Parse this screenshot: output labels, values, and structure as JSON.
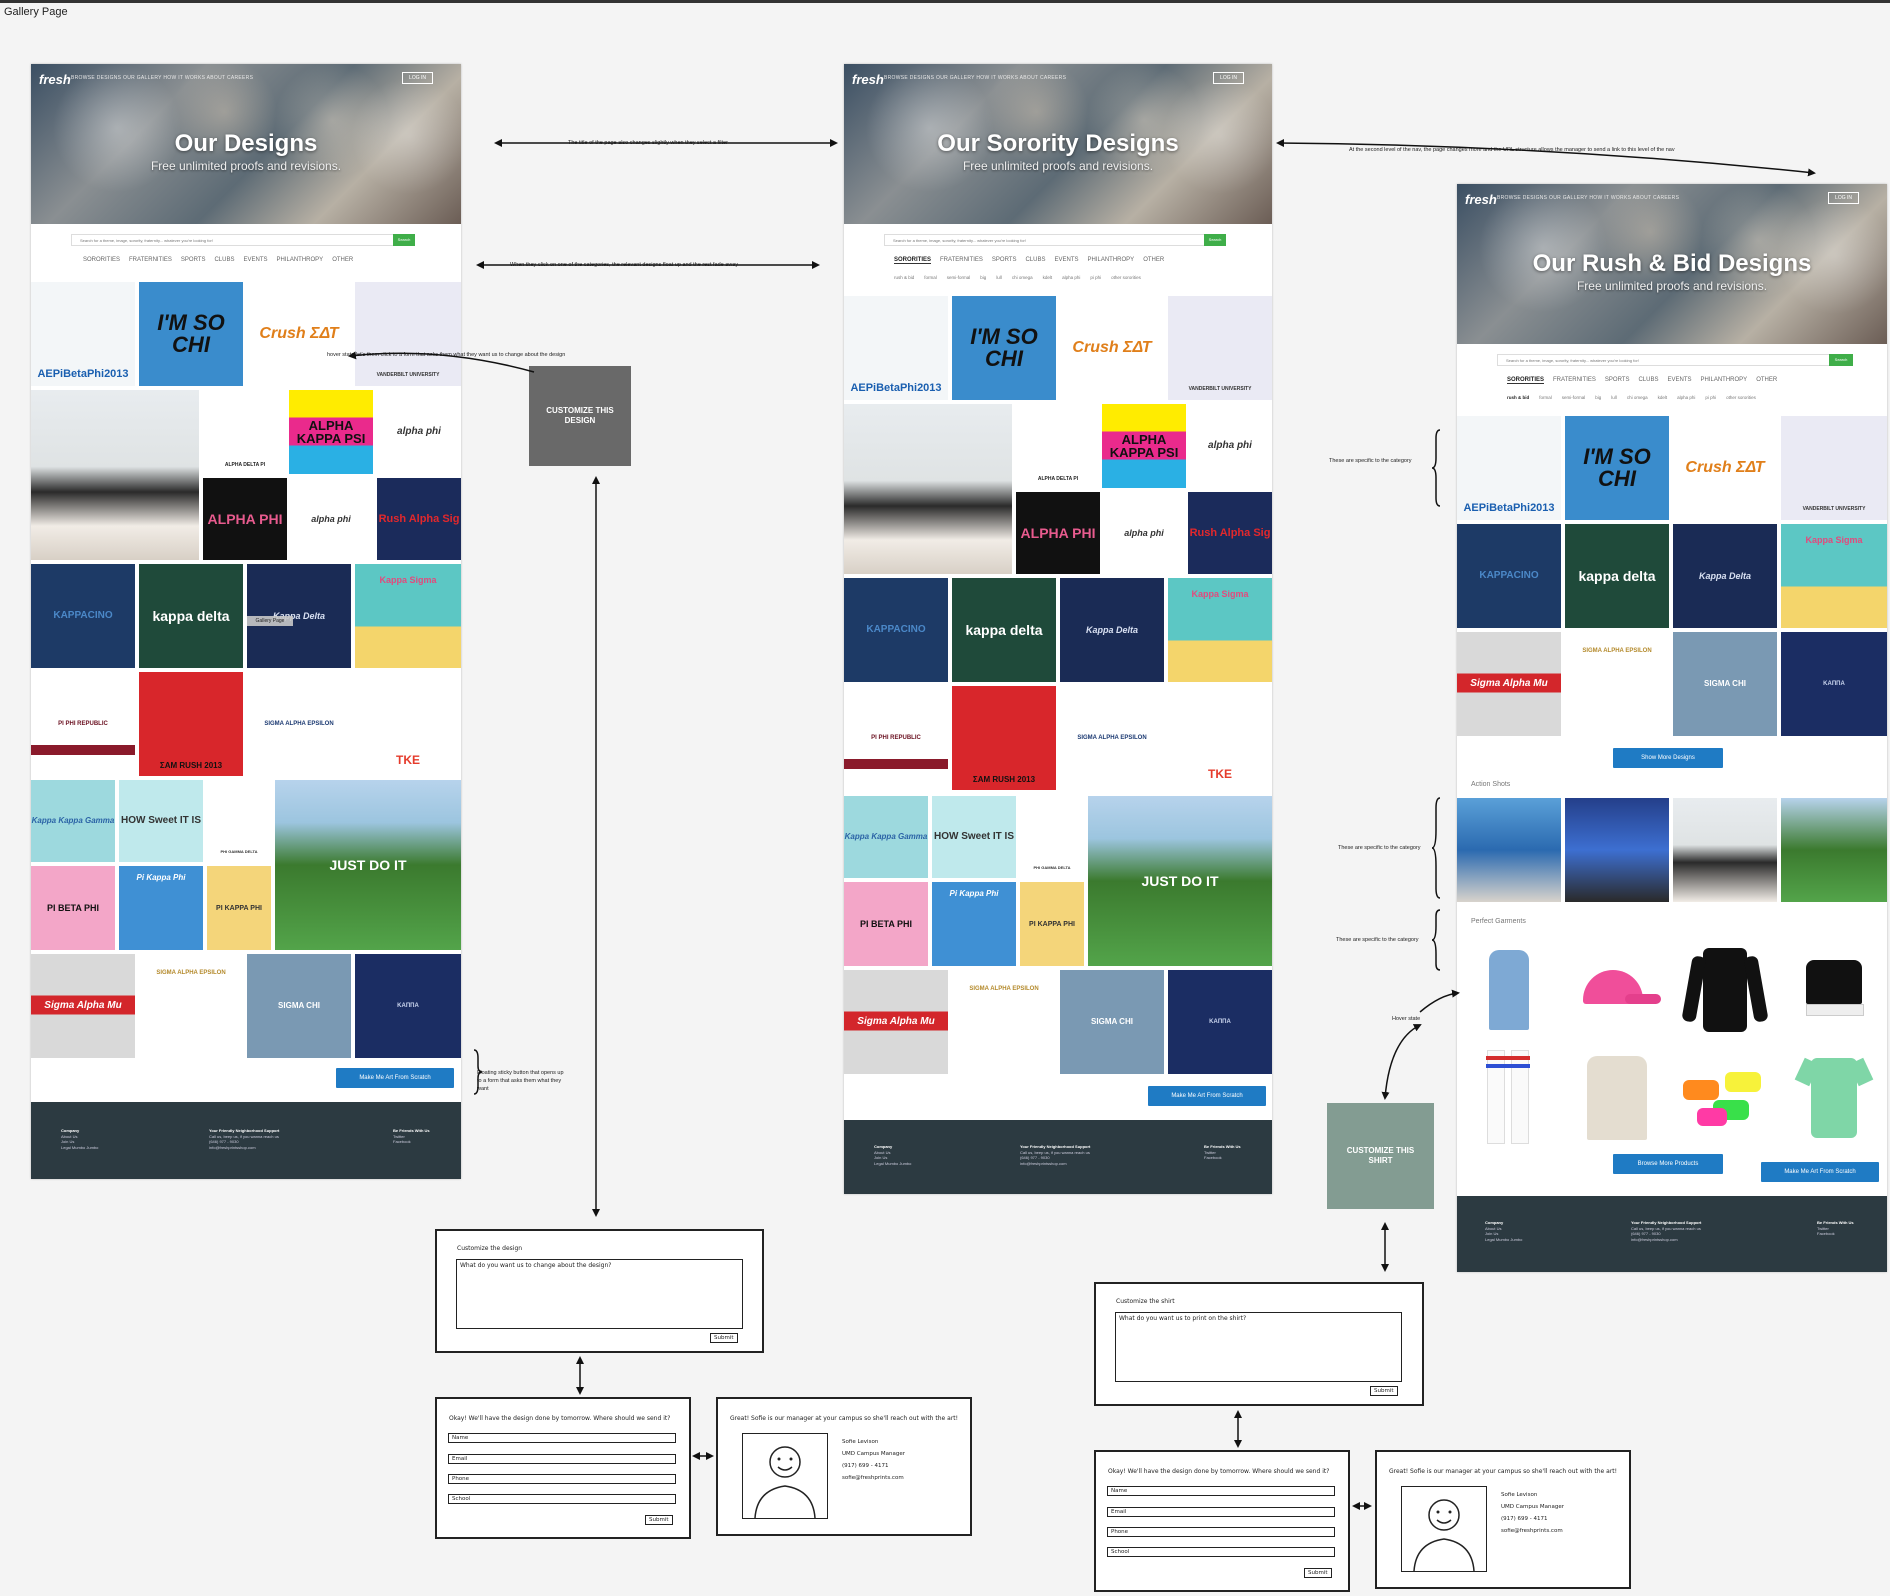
{
  "canvas": {
    "title": "Gallery Page"
  },
  "pages": [
    {
      "hero": {
        "logo": "fresh",
        "nav": "BROWSE DESIGNS   OUR GALLERY   HOW IT WORKS   ABOUT   CAREERS",
        "nav_button": "LOG IN",
        "title": "Our Designs",
        "subtitle": "Free unlimited proofs and revisions."
      },
      "search": {
        "placeholder": "Search for a theme, image, sorority, fraternity... whatever you're looking for!",
        "button": "Search"
      },
      "categories": [
        "SORORITIES",
        "FRATERNITIES",
        "SPORTS",
        "CLUBS",
        "EVENTS",
        "PHILANTHROPY",
        "OTHER"
      ],
      "cta": "Make Me Art From Scratch"
    },
    {
      "hero": {
        "logo": "fresh",
        "nav": "BROWSE DESIGNS   OUR GALLERY   HOW IT WORKS   ABOUT   CAREERS",
        "nav_button": "LOG IN",
        "title": "Our Sorority Designs",
        "subtitle": "Free unlimited proofs and revisions."
      },
      "search": {
        "placeholder": "Search for a theme, image, sorority, fraternity... whatever you're looking for!",
        "button": "Search"
      },
      "categories": [
        "SORORITIES",
        "FRATERNITIES",
        "SPORTS",
        "CLUBS",
        "EVENTS",
        "PHILANTHROPY",
        "OTHER"
      ],
      "subcategories": [
        "rush & bid",
        "formal",
        "semi-formal",
        "big",
        "lull",
        "chi omega",
        "kdelt",
        "alpha phi",
        "pi phi",
        "other sororities"
      ],
      "cta": "Make Me Art From Scratch"
    },
    {
      "hero": {
        "logo": "fresh",
        "nav": "BROWSE DESIGNS   OUR GALLERY   HOW IT WORKS   ABOUT   CAREERS",
        "nav_button": "LOG IN",
        "title": "Our Rush & Bid Designs",
        "subtitle": "Free unlimited proofs and revisions."
      },
      "search": {
        "placeholder": "Search for a theme, image, sorority, fraternity... whatever you're looking for!",
        "button": "Search"
      },
      "categories": [
        "SORORITIES",
        "FRATERNITIES",
        "SPORTS",
        "CLUBS",
        "EVENTS",
        "PHILANTHROPY",
        "OTHER"
      ],
      "subcategories": [
        "rush & bid",
        "formal",
        "semi-formal",
        "big",
        "lull",
        "chi omega",
        "kdelt",
        "alpha phi",
        "pi phi",
        "other sororities"
      ],
      "show_more": "Show More Designs",
      "action_shots_label": "Action Shots",
      "garments_label": "Perfect Garments",
      "browse_products": "Browse More Products",
      "cta": "Make Me Art From Scratch"
    }
  ],
  "tiles": {
    "aepi": "AEPiBetaPhi2013",
    "so_chi": "I'M SO CHI",
    "crush": "Crush ΣΔΤ",
    "peace": "VANDERBILT UNIVERSITY",
    "adpi": "ALPHA DELTA PI",
    "akpsi": "ALPHA KAPPA PSI",
    "aphi_circle": "alpha phi",
    "alpha_phi": "ALPHA PHI",
    "skull": "alpha phi",
    "rush_alpha_sig": "Rush Alpha Sig",
    "kappacino": "KAPPACINO",
    "kappa_delta": "kappa delta",
    "lighthouse": "Kappa Delta",
    "surf": "Kappa Sigma",
    "piphi_republic": "PI PHI REPUBLIC",
    "sam": "ΣΑΜ RUSH 2013",
    "sae_usa": "SIGMA ALPHA EPSILON",
    "tke": "TKE",
    "kappa_banner": "Kappa Kappa Gamma",
    "how_sweet": "HOW Sweet IT IS",
    "pi_gamma": "PHI GAMMA DELTA",
    "just_do_it": "JUST DO IT",
    "pi_beta_phi": "PI BETA PHI",
    "pi_kappa_phi_sand": "Pi Kappa Phi",
    "pi_kappa_phi": "PI KAPPA PHI",
    "sigma_alpha_mu": "Sigma Alpha Mu",
    "sae_lion": "SIGMA ALPHA EPSILON",
    "sigma_chi": "SIGMA CHI",
    "crest": "ΚΑΠΠΑ"
  },
  "footer": {
    "company_heading": "Company",
    "company_links": "About Us\nJoin Us\nLegal Mumbo Jumbo",
    "support_heading": "Your Friendly Neighborhood Support",
    "support_text": "Call us, beep us, if you wanna reach us\n(646) 977 - 9030\ninfo@freshprintsshop.com",
    "social_heading": "Be Friends With Us",
    "social_links": "Twitter\nFacebook"
  },
  "hover_states": {
    "customize_design": "CUSTOMIZE THIS DESIGN",
    "customize_shirt": "CUSTOMIZE THIS SHIRT",
    "small_hover_tag": "Gallery Page"
  },
  "annotations": {
    "title_change": "The title of the page also changes slightly when they select a filter",
    "categories_float": "When they click on one of the categories, the relevant designs float up and the rest fade away",
    "hover_form": "hover state let's them click to a form that asks them what they want us to change about the design",
    "sticky_button": "Floating sticky button that opens up to a form that asks them what they want",
    "second_level": "At the second level of the nav, the page changes more and the URL structure allows the manager to send a link to this level of the nav",
    "specific_1": "These are specific to the category",
    "specific_2": "These are specific to the category",
    "specific_3": "These are specific to the category",
    "hover_state": "Hover state"
  },
  "forms": {
    "customize_design": {
      "title": "Customize the design",
      "placeholder": "What do you want us to change about the design?",
      "submit": "Submit"
    },
    "customize_shirt": {
      "title": "Customize the shirt",
      "placeholder": "What do you want us to print on the shirt?",
      "submit": "Submit"
    },
    "contact": {
      "title": "Okay! We'll have the design done by tomorrow. Where should we send it?",
      "fields": [
        "Name",
        "Email",
        "Phone",
        "School"
      ],
      "submit": "Submit"
    },
    "manager": {
      "title": "Great! Sofie is our manager at your campus so she'll reach out with the art!",
      "name": "Sofie Levison",
      "role": "UMD Campus Manager",
      "phone": "(917) 699 - 4171",
      "email": "sofie@freshprints.com"
    }
  }
}
